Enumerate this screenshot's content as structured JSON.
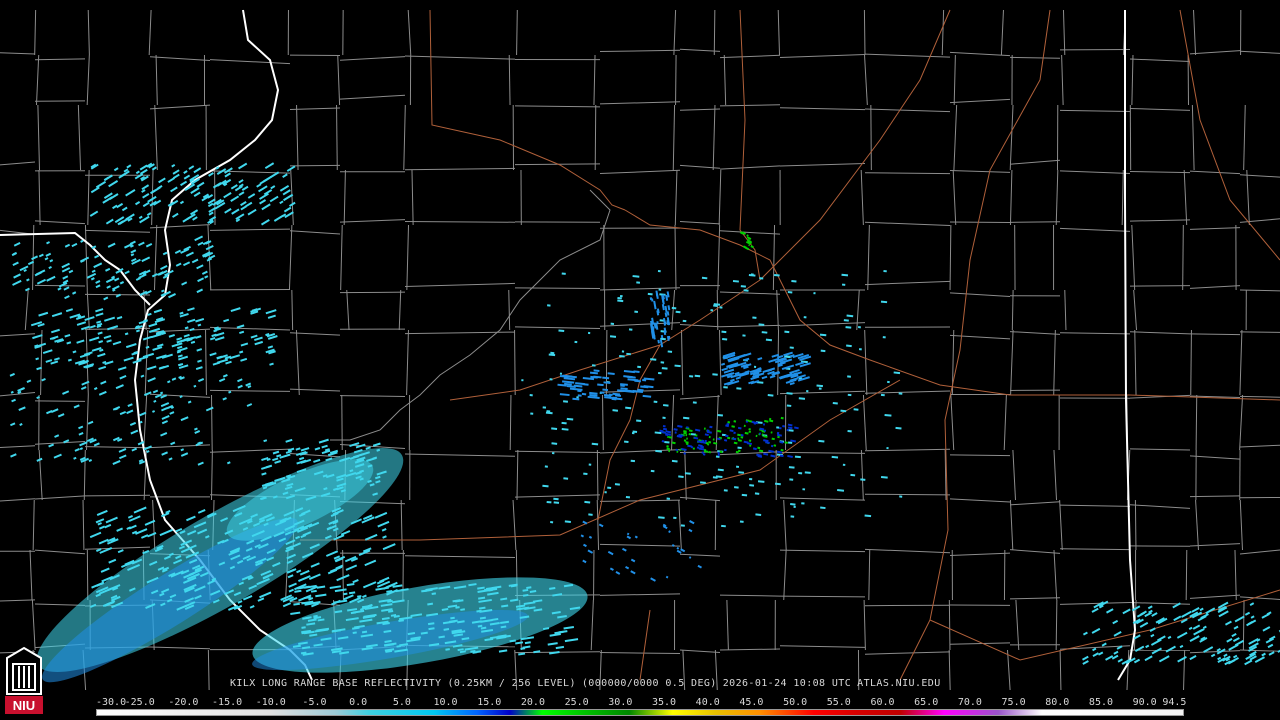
{
  "product_line": {
    "station": "KILX",
    "product": "LONG RANGE BASE REFLECTIVITY",
    "resolution": "(0.25KM / 256 LEVEL)",
    "volume": "(000000/0000 0.5 DEG)",
    "datetime": "2026-01-24 10:08 UTC",
    "site": "ATLAS.NIU.EDU"
  },
  "colorbar": {
    "labels": [
      "-30.0",
      "-25.0",
      "-20.0",
      "-15.0",
      "-10.0",
      "-5.0",
      "0.0",
      "5.0",
      "10.0",
      "15.0",
      "20.0",
      "25.0",
      "30.0",
      "35.0",
      "40.0",
      "45.0",
      "50.0",
      "55.0",
      "60.0",
      "65.0",
      "70.0",
      "75.0",
      "80.0",
      "85.0",
      "90.0",
      "94.5"
    ],
    "values": [
      -30,
      -25,
      -20,
      -15,
      -10,
      -5,
      0,
      5,
      10,
      15,
      20,
      25,
      30,
      35,
      40,
      45,
      50,
      55,
      60,
      65,
      70,
      75,
      80,
      85,
      90,
      94.5
    ],
    "min": -30,
    "max": 94.5
  },
  "logo": {
    "text": "NIU",
    "color": "#c8102e"
  },
  "map_colors": {
    "background": "#000000",
    "county_lines": "#8c8c8c",
    "state_lines": "#ffffff",
    "roads": "#b0603a",
    "echo_light": "#40d8ee",
    "echo_mid": "#2090e8",
    "echo_blue": "#0030d0",
    "echo_green": "#00d000"
  }
}
